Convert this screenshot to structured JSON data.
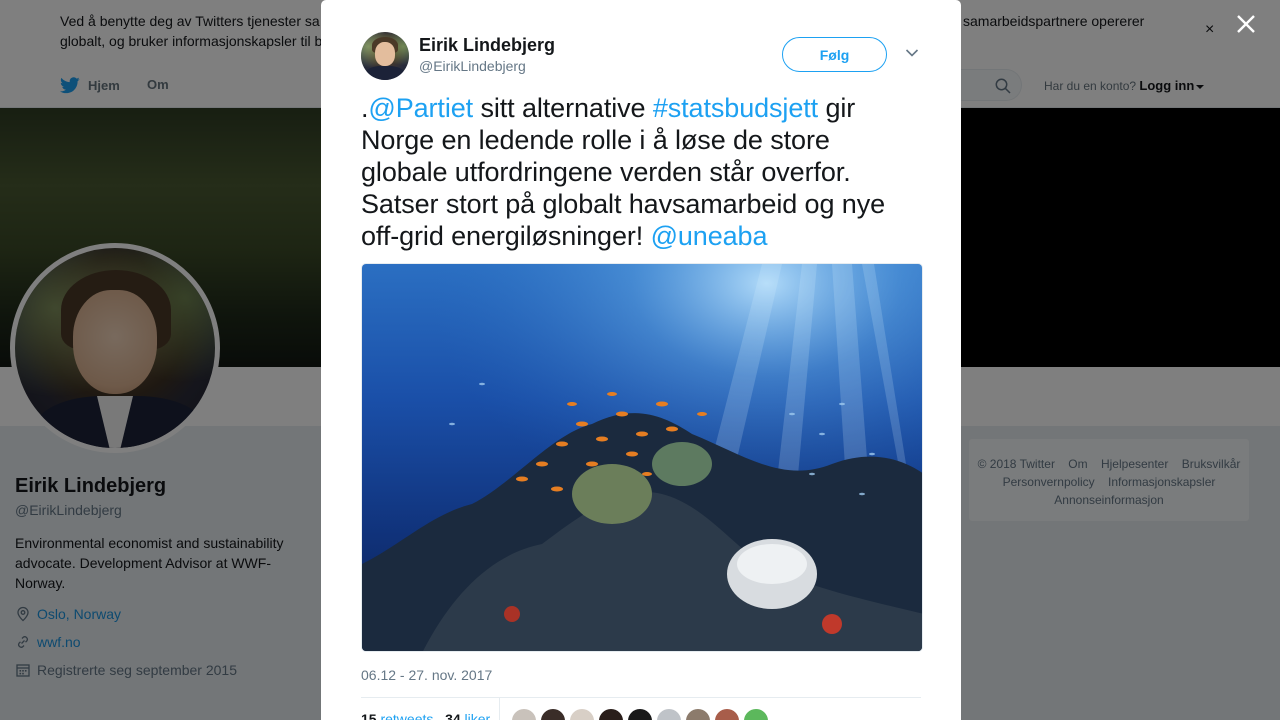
{
  "cookie": {
    "text_left": "Ved å benytte deg av Twitters tjenester sa globalt, og bruker informasjonskapsler til b",
    "line1": "Ved å benytte deg av Twitters tjenester sa",
    "line2": "globalt, og bruker informasjonskapsler til b",
    "right_fragment": "samarbeidspartnere opererer",
    "close_glyph": "×"
  },
  "nav": {
    "home": "Hjem",
    "about": "Om",
    "account_prompt": "Har du en konto?",
    "login": "Logg inn"
  },
  "profile": {
    "name": "Eirik Lindebjerg",
    "handle": "@EirikLindebjerg",
    "bio": "Environmental economist and sustainability advocate. Development Advisor at WWF-Norway.",
    "location": "Oslo, Norway",
    "url": "wwf.no",
    "joined": "Registrerte seg september 2015"
  },
  "footer": {
    "items": [
      "© 2018 Twitter",
      "Om",
      "Hjelpesenter",
      "Bruksvilkår",
      "Personvernpolicy",
      "Informasjonskapsler",
      "Annonseinformasjon"
    ]
  },
  "modal": {
    "name": "Eirik Lindebjerg",
    "handle": "@EirikLindebjerg",
    "follow": "Følg",
    "tweet": {
      "p1": ".",
      "m1": "@Partiet",
      "p2": " sitt alternative ",
      "h1": "#statsbudsjett",
      "p3": " gir Norge en ledende rolle i å løse de store globale utfordringene verden står overfor. Satser stort på globalt havsamarbeid og nye off-grid energiløsninger! ",
      "m2": "@uneaba"
    },
    "timestamp": "06.12 - 27. nov. 2017",
    "retweets_count": "15",
    "retweets_label": "retweets",
    "likes_count": "34",
    "likes_label": "liker"
  },
  "colors": {
    "accent": "#1da1f2",
    "text": "#14171a",
    "muted": "#657786",
    "likers": [
      "#c9c2bb",
      "#3a2d28",
      "#d8cfc6",
      "#2a1e1a",
      "#1a1a1a",
      "#bfc3c8",
      "#8c7b6c",
      "#a85d4a",
      "#5cb85c"
    ]
  }
}
